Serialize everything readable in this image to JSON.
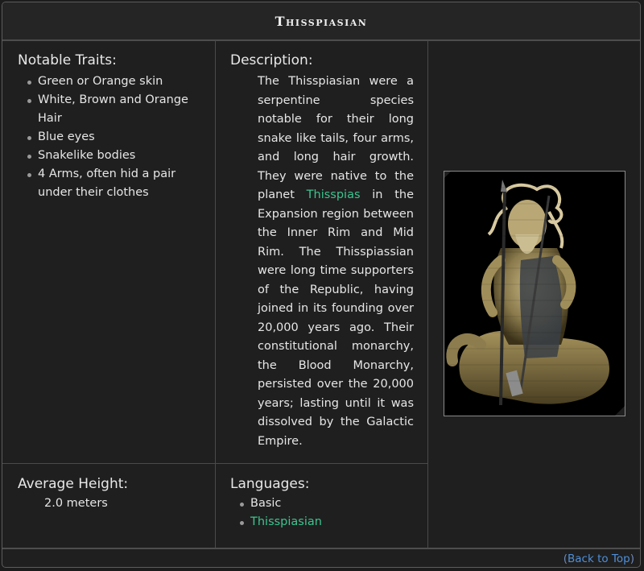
{
  "title": "Thisspiasian",
  "traits": {
    "heading": "Notable Traits:",
    "items": [
      "Green or Orange skin",
      "White, Brown and Orange Hair",
      "Blue eyes",
      "Snakelike bodies",
      "4 Arms, often hid a pair under their clothes"
    ]
  },
  "description": {
    "heading": "Description:",
    "text_before": "The Thisspiasian were a serpentine species notable for their long snake like tails, four arms, and long hair growth. They were native to the planet",
    "link": "Thisspias",
    "text_after": "in the Expansion region between the Inner Rim and Mid Rim. The Thisspiassian were long time supporters of the Republic, having joined in its founding over 20,000 years ago. Their constitutional monarchy, the Blood Monarchy, persisted over the 20,000 years; lasting until it was dissolved by the Galactic Empire."
  },
  "height": {
    "heading": "Average Height:",
    "value": "2.0 meters"
  },
  "languages": {
    "heading": "Languages:",
    "items": [
      "Basic",
      "Thisspiasian"
    ],
    "link_color": "#3dc48f"
  },
  "portrait": {
    "icon": "thisspiasian-portrait"
  },
  "footer": {
    "open": "(",
    "back_to_top": "Back to Top",
    "close": ")"
  },
  "colors": {
    "background": "#1f1f1f",
    "border": "#4a4a4a",
    "accent_link": "#3dc48f",
    "back_link": "#4f8fd9"
  }
}
